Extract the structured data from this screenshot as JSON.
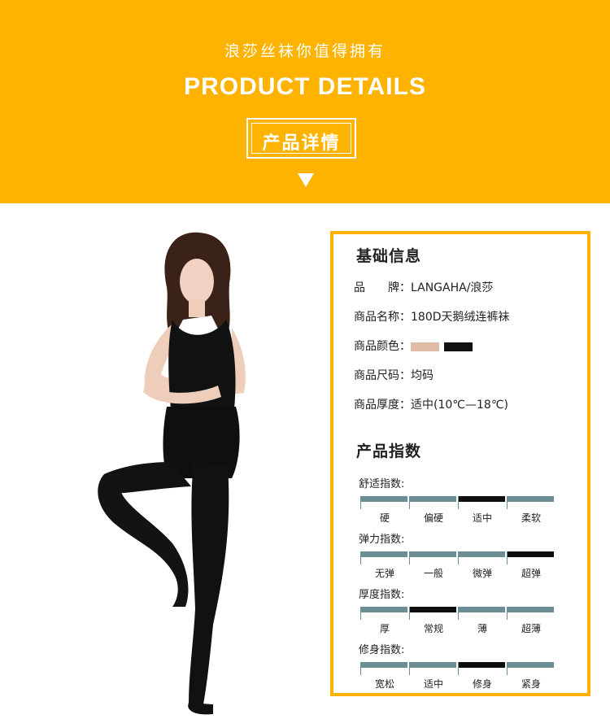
{
  "header": {
    "subtitle": "浪莎丝袜你值得拥有",
    "title_en": "PRODUCT DETAILS",
    "title_cn": "产品详情"
  },
  "basic_info": {
    "heading": "基础信息",
    "brand_label": "品　　牌：",
    "brand_value": "LANGAHA/浪莎",
    "name_label": "商品名称：",
    "name_value": "180D天鹅绒连裤袜",
    "color_label": "商品颜色：",
    "colors": [
      "#e0bca7",
      "#111111"
    ],
    "size_label": "商品尺码：",
    "size_value": "均码",
    "thickness_label": "商品厚度：",
    "thickness_value": "适中(10℃—18℃)"
  },
  "indices": {
    "heading": "产品指数",
    "bar_color": "#6b8e96",
    "active_color": "#0e0e0e",
    "items": [
      {
        "label": "舒适指数:",
        "options": [
          "硬",
          "偏硬",
          "适中",
          "柔软"
        ],
        "active": 2
      },
      {
        "label": "弹力指数:",
        "options": [
          "无弹",
          "一般",
          "微弹",
          "超弹"
        ],
        "active": 3
      },
      {
        "label": "厚度指数:",
        "options": [
          "厚",
          "常规",
          "薄",
          "超薄"
        ],
        "active": 1
      },
      {
        "label": "修身指数:",
        "options": [
          "宽松",
          "适中",
          "修身",
          "紧身"
        ],
        "active": 2
      }
    ]
  },
  "colors": {
    "banner": "#fdb300",
    "border": "#fdb300"
  }
}
